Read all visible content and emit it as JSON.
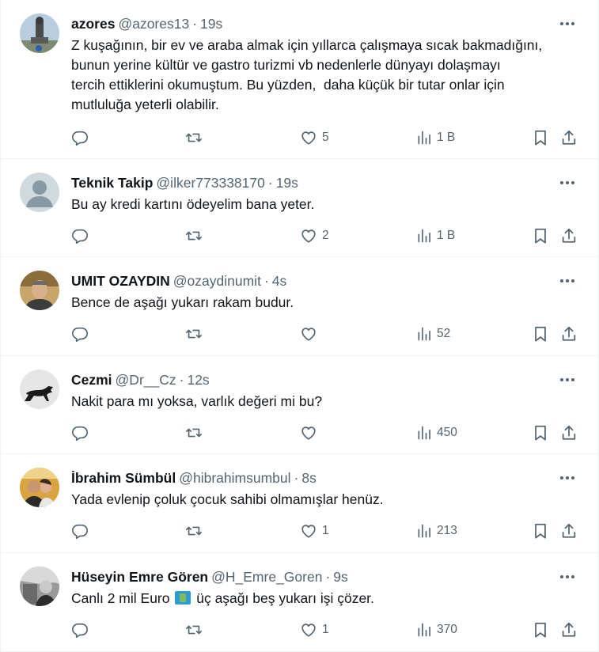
{
  "tweets": [
    {
      "name": "azores",
      "handle": "@azores13",
      "time": "19s",
      "text": "Z kuşağının, bir ev ve araba almak için yıllarca çalışmaya sıcak bakmadığını,\nbunun yerine kültür ve gastro turizmi vb nedenlerle dünyayı dolaşmayı\ntercih ettiklerini okumuştum. Bu yüzden,  daha küçük bir tutar onlar için\nmutluluğa yeterli olabilir.",
      "replies": "",
      "retweets": "",
      "likes": "5",
      "views": "1 B"
    },
    {
      "name": "Teknik Takip",
      "handle": "@ilker773338170",
      "time": "19s",
      "text": "Bu ay kredi kartını ödeyelim bana yeter.",
      "replies": "",
      "retweets": "",
      "likes": "2",
      "views": "1 B"
    },
    {
      "name": "UMIT OZAYDIN",
      "handle": "@ozaydinumit",
      "time": "4s",
      "text": "Bence de aşağı yukarı rakam budur.",
      "replies": "",
      "retweets": "",
      "likes": "",
      "views": "52"
    },
    {
      "name": "Cezmi",
      "handle": "@Dr__Cz",
      "time": "12s",
      "text": "Nakit para mı yoksa, varlık değeri mi bu?",
      "replies": "",
      "retweets": "",
      "likes": "",
      "views": "450"
    },
    {
      "name": "İbrahim Sümbül",
      "handle": "@hibrahimsumbul",
      "time": "8s",
      "text": "Yada evlenip çoluk çocuk sahibi olmamışlar henüz.",
      "replies": "",
      "retweets": "",
      "likes": "1",
      "views": "213"
    },
    {
      "name": "Hüseyin Emre Gören",
      "handle": "@H_Emre_Goren",
      "time": "9s",
      "text_before": "Canlı 2 mil Euro ",
      "text_after": " üç aşağı beş yukarı işi çözer.",
      "emoji": "euro-banknote-emoji",
      "replies": "",
      "retweets": "",
      "likes": "1",
      "views": "370"
    }
  ],
  "separator": "·",
  "colors": {
    "text": "#0f1419",
    "muted": "#536471",
    "divider": "#eff3f4"
  }
}
